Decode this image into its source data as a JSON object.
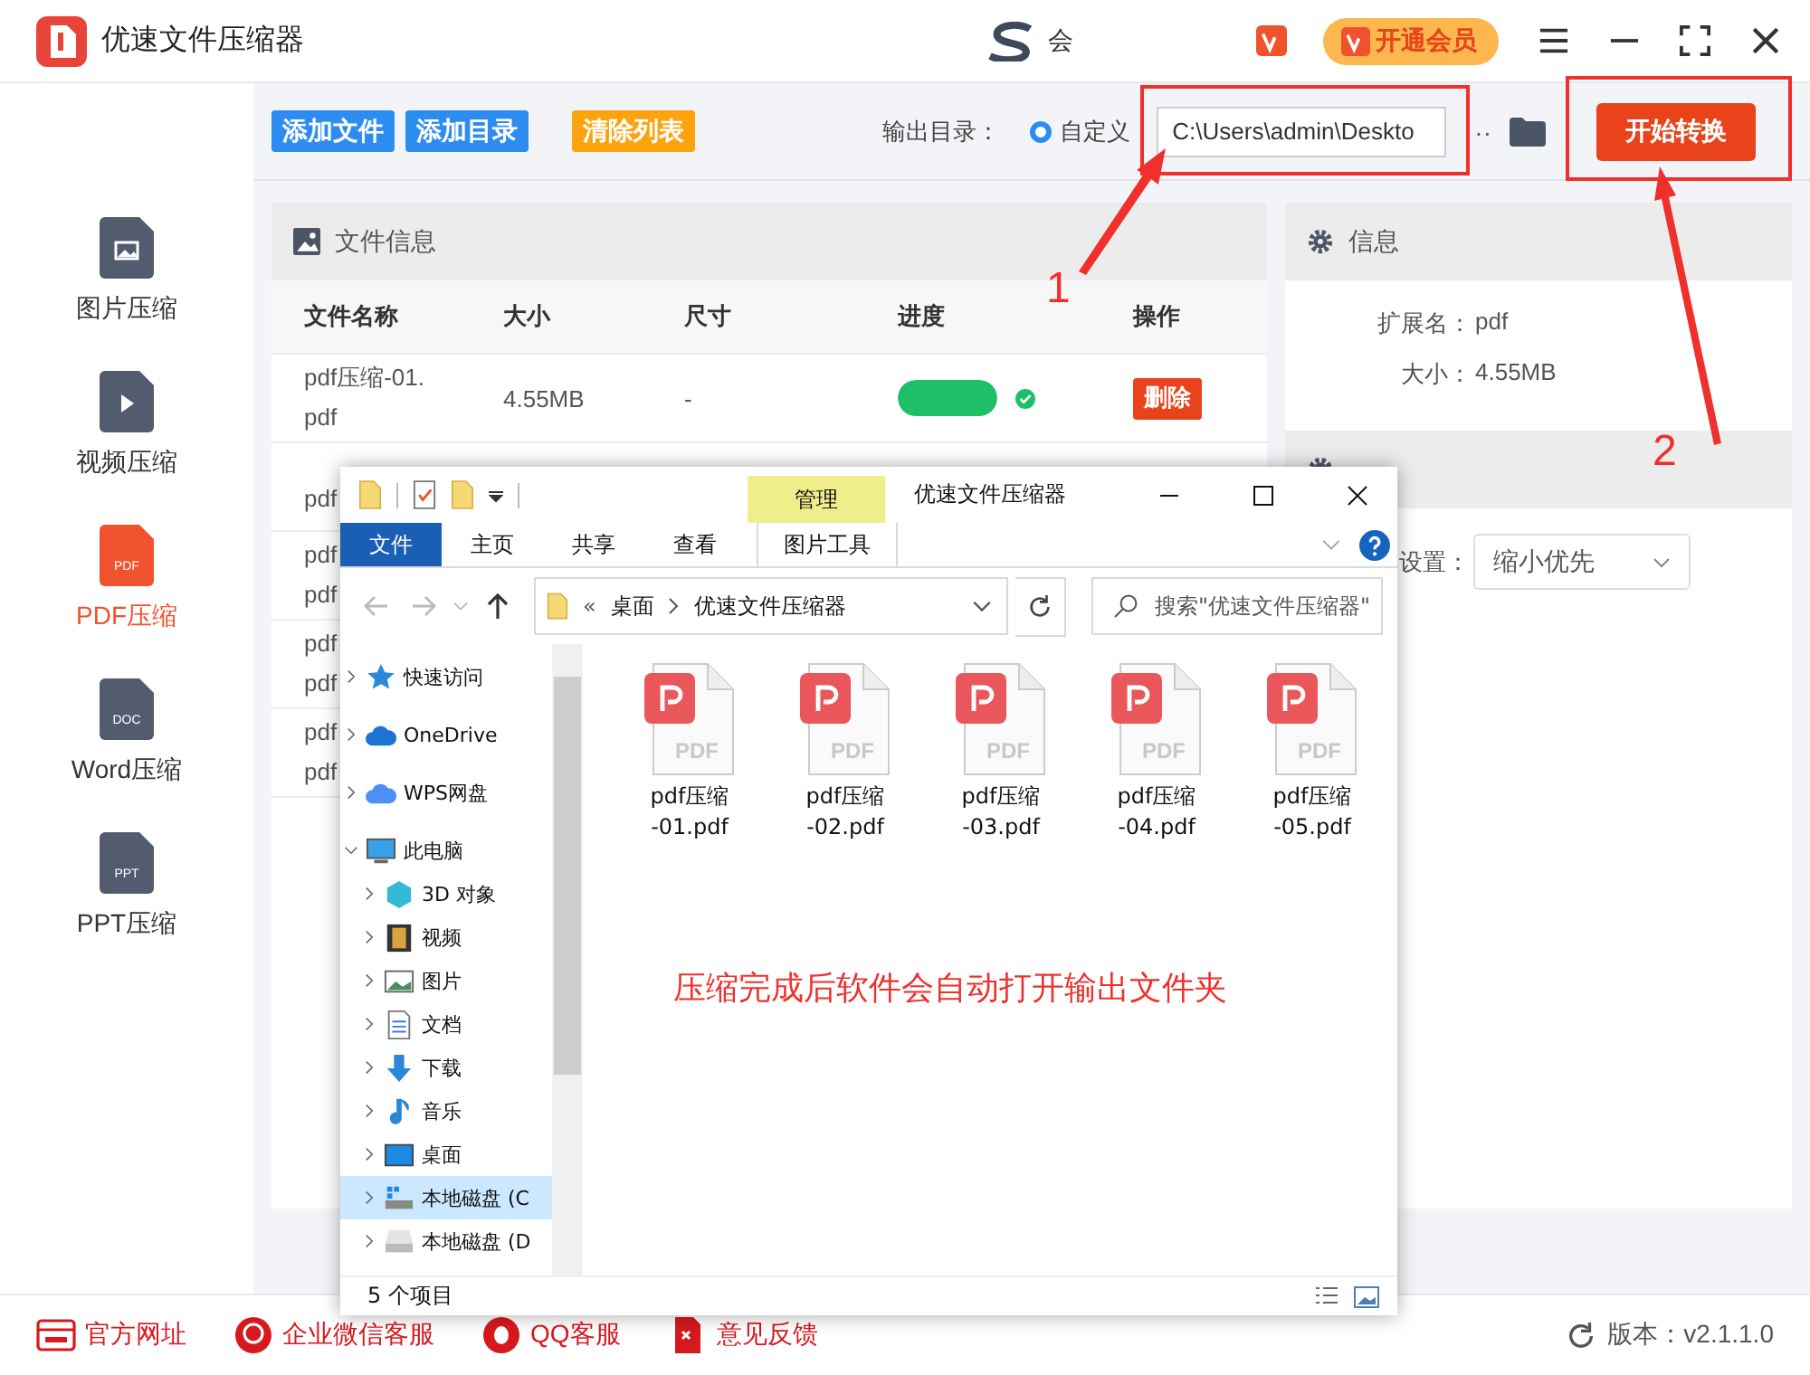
{
  "app": {
    "title": "优速文件压缩器",
    "account_text": "会",
    "vip_button": "开通会员"
  },
  "sidebar": {
    "items": [
      {
        "kind": "image",
        "label": "图片压缩",
        "selected": false
      },
      {
        "kind": "video",
        "label": "视频压缩",
        "selected": false
      },
      {
        "kind": "doc",
        "badge": "PDF",
        "label": "PDF压缩",
        "selected": true
      },
      {
        "kind": "doc",
        "badge": "DOC",
        "label": "Word压缩",
        "selected": false
      },
      {
        "kind": "doc",
        "badge": "PPT",
        "label": "PPT压缩",
        "selected": false
      }
    ]
  },
  "toolbar": {
    "buttons": [
      {
        "label": "添加文件",
        "kind": "primary"
      },
      {
        "label": "添加目录",
        "kind": "primary"
      },
      {
        "label": "清除列表",
        "kind": "warning"
      }
    ],
    "output_label": "输出目录：",
    "radio": {
      "label": "自定义",
      "selected": true
    },
    "path": "C:\\Users\\admin\\Deskto",
    "more": "··",
    "start_button": "开始转换"
  },
  "file_panel": {
    "title": "文件信息",
    "columns": [
      "文件名称",
      "大小",
      "尺寸",
      "进度",
      "操作"
    ],
    "rows": [
      {
        "name_lines": [
          "pdf压缩-01.",
          "pdf"
        ],
        "size": "4.55MB",
        "dimension": "-",
        "progress": {
          "level": 1,
          "done": true
        },
        "action": "删除"
      },
      {
        "name_lines": [
          "pdf"
        ]
      },
      {
        "name_lines": [
          "pdf",
          "pdf"
        ]
      },
      {
        "name_lines": [
          "pdf",
          "pdf"
        ]
      },
      {
        "name_lines": [
          "pdf",
          "pdf"
        ]
      }
    ]
  },
  "info_panel": {
    "title": "信息",
    "fields": [
      {
        "label": "扩展名：",
        "value": "pdf"
      },
      {
        "label": "大小：",
        "value": "4.55MB"
      }
    ],
    "setting_label": "设置：",
    "setting_value": "缩小优先"
  },
  "explorer": {
    "title": "优速文件压缩器",
    "tool_tab": "管理",
    "tool_ribbon": "图片工具",
    "tabs": [
      {
        "label": "文件",
        "selected": true
      },
      {
        "label": "主页",
        "selected": false
      },
      {
        "label": "共享",
        "selected": false
      },
      {
        "label": "查看",
        "selected": false
      }
    ],
    "path_prefix": "«",
    "path": [
      "桌面",
      "优速文件压缩器"
    ],
    "search_placeholder": "搜索\"优速文件压缩器\"",
    "nav": [
      {
        "label": "快速访问",
        "expanded": false,
        "selected": false
      },
      {
        "label": "OneDrive",
        "expanded": false,
        "selected": false
      },
      {
        "label": "WPS网盘",
        "expanded": false,
        "selected": false
      },
      {
        "label": "此电脑",
        "expanded": true,
        "selected": false,
        "children": [
          {
            "label": "3D 对象",
            "expanded": false,
            "selected": false
          },
          {
            "label": "视频",
            "expanded": false,
            "selected": false
          },
          {
            "label": "图片",
            "expanded": false,
            "selected": false
          },
          {
            "label": "文档",
            "expanded": false,
            "selected": false
          },
          {
            "label": "下载",
            "expanded": false,
            "selected": false
          },
          {
            "label": "音乐",
            "expanded": false,
            "selected": false
          },
          {
            "label": "桌面",
            "expanded": false,
            "selected": false
          },
          {
            "label": "本地磁盘 (C",
            "expanded": false,
            "selected": true
          },
          {
            "label": "本地磁盘 (D",
            "expanded": false,
            "selected": false
          }
        ]
      }
    ],
    "files": [
      {
        "badge": "PDF",
        "name_lines": [
          "pdf压缩",
          "-01.pdf"
        ]
      },
      {
        "badge": "PDF",
        "name_lines": [
          "pdf压缩",
          "-02.pdf"
        ]
      },
      {
        "badge": "PDF",
        "name_lines": [
          "pdf压缩",
          "-03.pdf"
        ]
      },
      {
        "badge": "PDF",
        "name_lines": [
          "pdf压缩",
          "-04.pdf"
        ]
      },
      {
        "badge": "PDF",
        "name_lines": [
          "pdf压缩",
          "-05.pdf"
        ]
      }
    ],
    "status": "5 个项目"
  },
  "annotations": {
    "markers": [
      "1",
      "2"
    ],
    "note": "压缩完成后软件会自动打开输出文件夹"
  },
  "footer": {
    "links": [
      {
        "kind": "web",
        "label": "官方网址"
      },
      {
        "kind": "chat",
        "label": "企业微信客服"
      },
      {
        "kind": "qq",
        "label": "QQ客服"
      },
      {
        "kind": "feedback",
        "label": "意见反馈"
      }
    ],
    "version": "版本：v2.1.1.0"
  }
}
